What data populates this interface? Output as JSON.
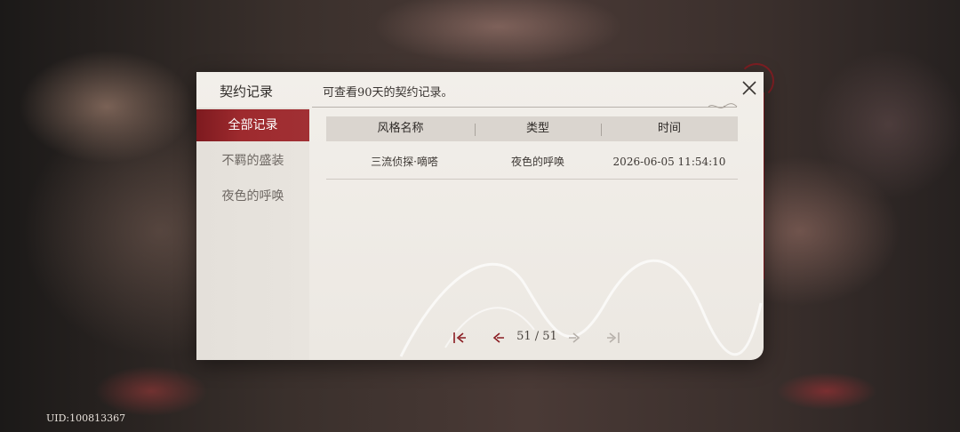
{
  "modal": {
    "title": "契约记录",
    "subtitle": "可查看90天的契约记录。"
  },
  "sidebar": {
    "items": [
      {
        "label": "全部记录",
        "active": true
      },
      {
        "label": "不羁的盛装",
        "active": false
      },
      {
        "label": "夜色的呼唤",
        "active": false
      }
    ]
  },
  "table": {
    "headers": [
      "风格名称",
      "类型",
      "时间"
    ],
    "rows": [
      [
        "三流侦探·嘀嗒",
        "夜色的呼唤",
        "2026-06-05 11:54:10"
      ]
    ]
  },
  "pagination": {
    "text": "51 / 51",
    "current": 51,
    "total": 51
  },
  "footer": {
    "uid": "UID:100813367"
  },
  "colors": {
    "accent": "#9e2a2e",
    "panel": "#f0ece6",
    "header_row": "#dad5cf"
  },
  "icons": [
    "close-icon",
    "first-page-icon",
    "prev-page-icon",
    "next-page-icon",
    "last-page-icon"
  ]
}
